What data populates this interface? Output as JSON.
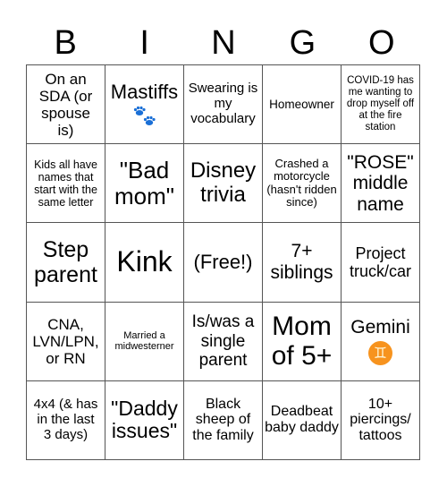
{
  "header": {
    "letters": [
      "B",
      "I",
      "N",
      "G",
      "O"
    ]
  },
  "cells": [
    {
      "text": "On an SDA (or spouse is)"
    },
    {
      "text": "Mastiffs",
      "icon": "paw-prints-icon"
    },
    {
      "text": "Swearing is my vocabulary"
    },
    {
      "text": "Homeowner"
    },
    {
      "text": "COVID-19 has me wanting to drop myself off at the fire station"
    },
    {
      "text": "Kids all have names that start with the same letter"
    },
    {
      "text": "\"Bad mom\""
    },
    {
      "text": "Disney trivia"
    },
    {
      "text": "Crashed a motorcycle (hasn't ridden since)"
    },
    {
      "text": "\"ROSE\" middle name"
    },
    {
      "text": "Step parent"
    },
    {
      "text": "Kink"
    },
    {
      "text": "(Free!)"
    },
    {
      "text": "7+ siblings"
    },
    {
      "text": "Project truck/car"
    },
    {
      "text": "CNA, LVN/LPN, or RN"
    },
    {
      "text": "Married a midwesterner"
    },
    {
      "text": "Is/was a single parent"
    },
    {
      "text": "Mom of 5+"
    },
    {
      "text": "Gemini",
      "icon": "gemini-zodiac-icon",
      "icon_glyph": "♊"
    },
    {
      "text": "4x4 (& has in the last 3 days)"
    },
    {
      "text": "\"Daddy issues\""
    },
    {
      "text": "Black sheep of the family"
    },
    {
      "text": "Deadbeat baby daddy"
    },
    {
      "text": "10+ piercings/ tattoos"
    }
  ],
  "colors": {
    "paw": "#1a6fd6",
    "gemini_badge": "#f7931e",
    "grid_line": "#555555"
  }
}
